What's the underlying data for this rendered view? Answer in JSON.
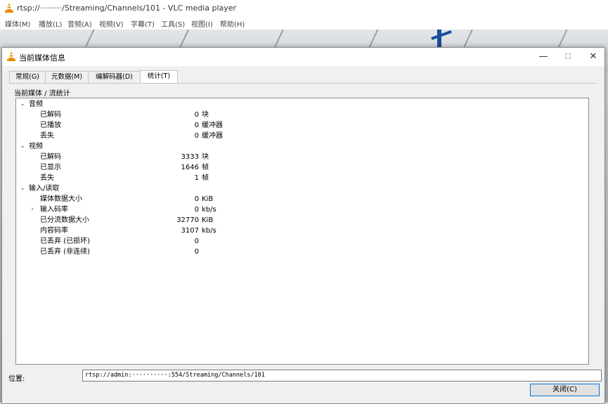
{
  "main_window": {
    "title": "rtsp://·········/Streaming/Channels/101 - VLC media player",
    "menu": [
      "媒体(M)",
      "播放(L)",
      "音频(A)",
      "视频(V)",
      "字幕(T)",
      "工具(S)",
      "视图(I)",
      "帮助(H)"
    ]
  },
  "dialog": {
    "title": "当前媒体信息",
    "minimize": "—",
    "maximize": "☐",
    "close": "✕",
    "tabs": [
      "常规(G)",
      "元数据(M)",
      "编解码器(D)",
      "统计(T)"
    ],
    "active_tab": "统计(T)",
    "breadcrumb": "当前媒体 / 流统计",
    "stats": [
      {
        "label": "音频",
        "level": 0,
        "expander": "⌄",
        "value": "",
        "unit": ""
      },
      {
        "label": "已解码",
        "level": 1,
        "expander": "",
        "value": "0",
        "unit": "块"
      },
      {
        "label": "已播放",
        "level": 1,
        "expander": "",
        "value": "0",
        "unit": "缓冲器"
      },
      {
        "label": "丢失",
        "level": 1,
        "expander": "",
        "value": "0",
        "unit": "缓冲器"
      },
      {
        "label": "视频",
        "level": 0,
        "expander": "⌄",
        "value": "",
        "unit": ""
      },
      {
        "label": "已解码",
        "level": 1,
        "expander": "",
        "value": "3333",
        "unit": "块"
      },
      {
        "label": "已显示",
        "level": 1,
        "expander": "",
        "value": "1646",
        "unit": "帧"
      },
      {
        "label": "丢失",
        "level": 1,
        "expander": "",
        "value": "1",
        "unit": "帧"
      },
      {
        "label": "输入/读取",
        "level": 0,
        "expander": "⌄",
        "value": "",
        "unit": ""
      },
      {
        "label": "媒体数据大小",
        "level": 1,
        "expander": "",
        "value": "0",
        "unit": "KiB"
      },
      {
        "label": "输入码率",
        "level": 1,
        "expander": "›",
        "value": "0",
        "unit": "kb/s"
      },
      {
        "label": "已分流数据大小",
        "level": 1,
        "expander": "",
        "value": "32770",
        "unit": "KiB"
      },
      {
        "label": "内容码率",
        "level": 1,
        "expander": "",
        "value": "3107",
        "unit": "kb/s"
      },
      {
        "label": "已丢弃 (已损坏)",
        "level": 1,
        "expander": "",
        "value": "0",
        "unit": ""
      },
      {
        "label": "已丢弃 (非连续)",
        "level": 1,
        "expander": "",
        "value": "0",
        "unit": ""
      }
    ],
    "location_label": "位置:",
    "location_value": "rtsp://admin:··········:554/Streaming/Channels/101",
    "close_button": "关闭(C)"
  },
  "colors": {
    "accent": "#0078d7",
    "cone_orange": "#f08a00"
  }
}
